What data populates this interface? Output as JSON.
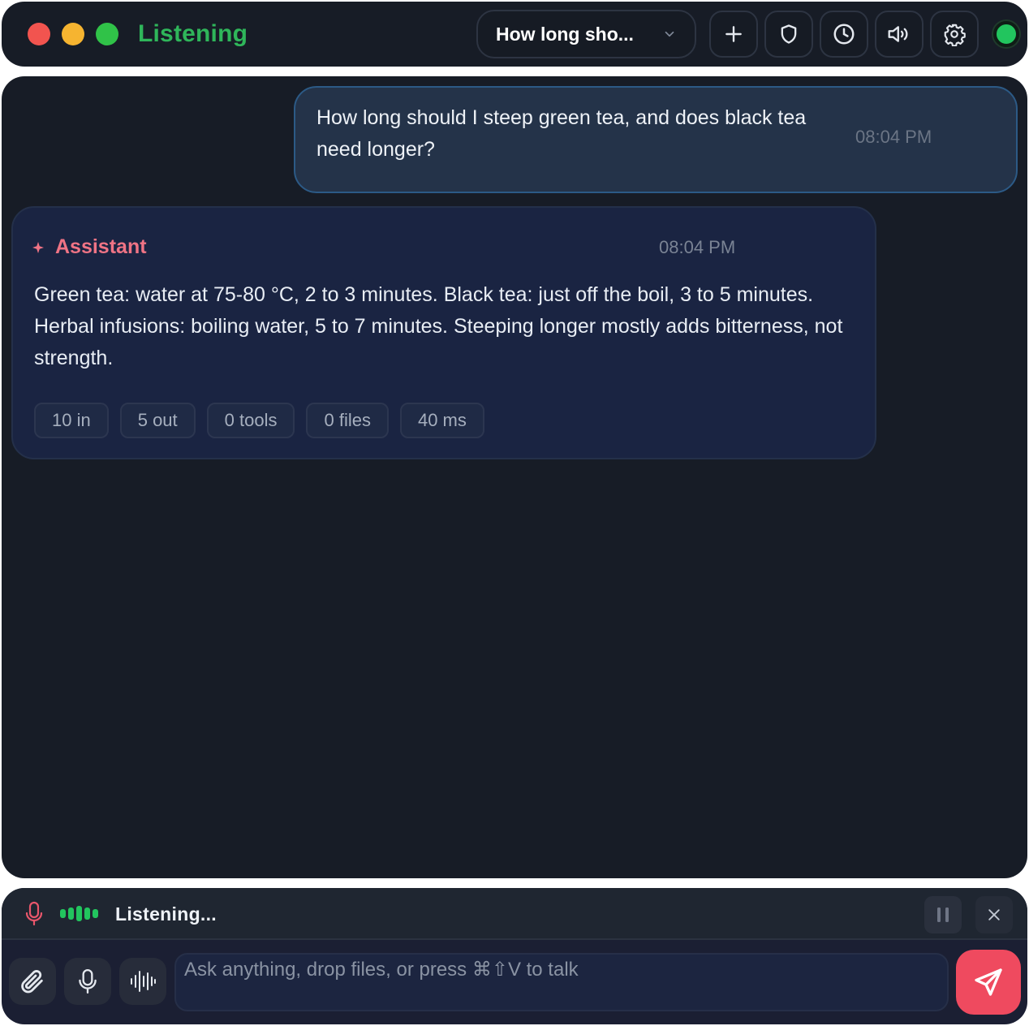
{
  "window": {
    "title": "Listening",
    "traffic_lights": {
      "close": "#f2544f",
      "minimize": "#f6b430",
      "maximize": "#30c248"
    },
    "accent": "#2fb65a"
  },
  "header": {
    "conversation_title": "How long sho...",
    "buttons": [
      "new-chat",
      "privacy-shield",
      "history",
      "voice-output",
      "settings"
    ],
    "status_color": "#22c55e"
  },
  "messages": [
    {
      "role": "user",
      "text": "How long should I steep green tea, and does black tea need longer?",
      "time": "08:04 PM"
    },
    {
      "role": "assistant",
      "label": "Assistant",
      "text": "Green tea: water at 75-80 °C, 2 to 3 minutes. Black tea: just off the boil, 3 to 5 minutes. Herbal infusions: boiling water, 5 to 7 minutes. Steeping longer mostly adds bitterness, not strength.",
      "time": "08:04 PM",
      "stats": {
        "tokens_in": "10 in",
        "tokens_out": "5 out",
        "tools": "0 tools",
        "files": "0 files",
        "latency": "40 ms"
      }
    }
  ],
  "voice": {
    "status": "Listening...",
    "level_color": "#22c55e"
  },
  "composer": {
    "placeholder": "Ask anything, drop files, or press ⌘⇧V to talk",
    "value": "",
    "send_color": "#ef4a5f"
  }
}
